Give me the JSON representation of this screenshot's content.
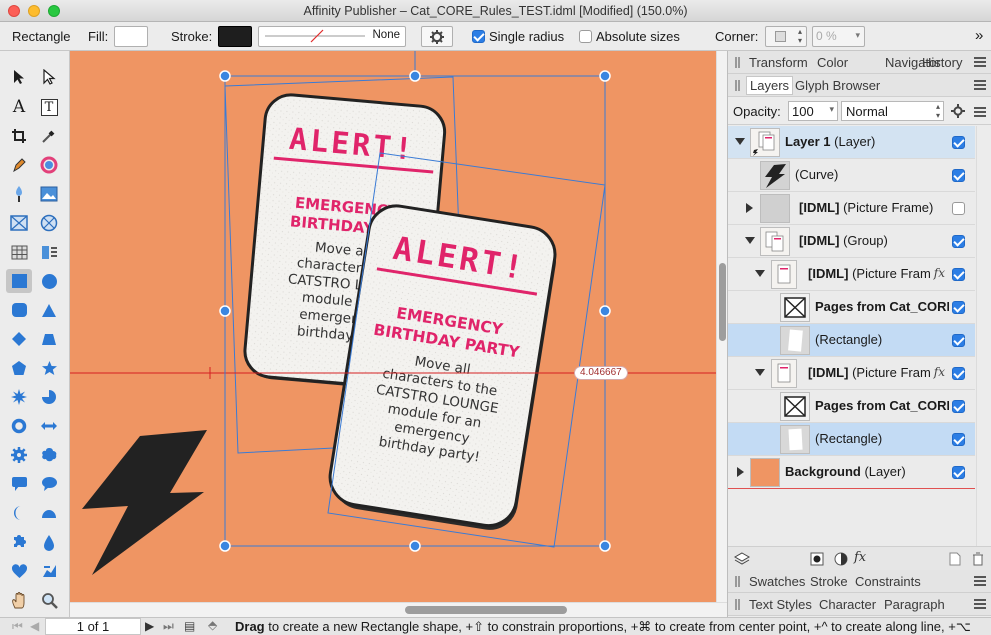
{
  "window": {
    "title": "Affinity Publisher – Cat_CORE_Rules_TEST.idml [Modified] (150.0%)"
  },
  "context_toolbar": {
    "tool_name": "Rectangle",
    "fill_label": "Fill:",
    "stroke_label": "Stroke:",
    "stroke_style": "None",
    "single_radius_label": "Single radius",
    "single_radius_checked": true,
    "absolute_sizes_label": "Absolute sizes",
    "absolute_sizes_checked": false,
    "corner_label": "Corner:",
    "corner_value": "0 %",
    "more": "»"
  },
  "canvas": {
    "guide_readout": "4.046667",
    "card": {
      "heading": "ALERT!",
      "subtitle_line1": "EMERGENCY",
      "subtitle_line2": "BIRTHDAY PARTY",
      "body_lines": [
        "Move all",
        "characters to the",
        "CATSTRO LOUNGE",
        "module for an",
        "emergency",
        "birthday party!"
      ]
    },
    "back_card": {
      "subtitle_line1": "EMERGENCY",
      "subtitle_line2": "BIRTHDAY PA",
      "body_lines": [
        "Move all",
        "characters to",
        "CATSTRO LOUN",
        "module for",
        "emergency",
        "birthday pa"
      ]
    },
    "colors": {
      "background": "#ef9563",
      "accent": "#e0246a",
      "card": "#f4f3f1",
      "selection": "#3a7bd5"
    }
  },
  "panel": {
    "top_tabs": [
      "Transform",
      "Color",
      "Navigator",
      "History"
    ],
    "layers_tabs": [
      "Layers",
      "Glyph Browser"
    ],
    "opacity_label": "Opacity:",
    "opacity_value": "100",
    "blend_mode": "Normal",
    "layers": [
      {
        "name": "Layer 1",
        "type": "(Layer)",
        "visible": true
      },
      {
        "name": "",
        "type": "(Curve)",
        "visible": true
      },
      {
        "name": "[IDML]",
        "type": "(Picture Frame)",
        "visible": false
      },
      {
        "name": "[IDML]",
        "type": "(Group)",
        "visible": true
      },
      {
        "name": "[IDML]",
        "type": "(Picture Fram",
        "visible": true,
        "fx": "fx"
      },
      {
        "name": "Pages from Cat_CORE",
        "type": "",
        "visible": true
      },
      {
        "name": "",
        "type": "(Rectangle)",
        "visible": true
      },
      {
        "name": "[IDML]",
        "type": "(Picture Fram",
        "visible": true,
        "fx": "fx"
      },
      {
        "name": "Pages from Cat_CORE",
        "type": "",
        "visible": true
      },
      {
        "name": "",
        "type": "(Rectangle)",
        "visible": true
      },
      {
        "name": "Background",
        "type": "(Layer)",
        "visible": true
      }
    ],
    "bottom_tabs_1": [
      "Swatches",
      "Stroke",
      "Constraints"
    ],
    "bottom_tabs_2": [
      "Text Styles",
      "Character",
      "Paragraph"
    ],
    "fx_button": "fx"
  },
  "status": {
    "page_indicator": "1 of 1",
    "hint_bold": "Drag",
    "hint_text": " to create a new Rectangle shape, +⇧ to constrain proportions, +⌘ to create from center point, +^ to create along line, +⌥"
  }
}
